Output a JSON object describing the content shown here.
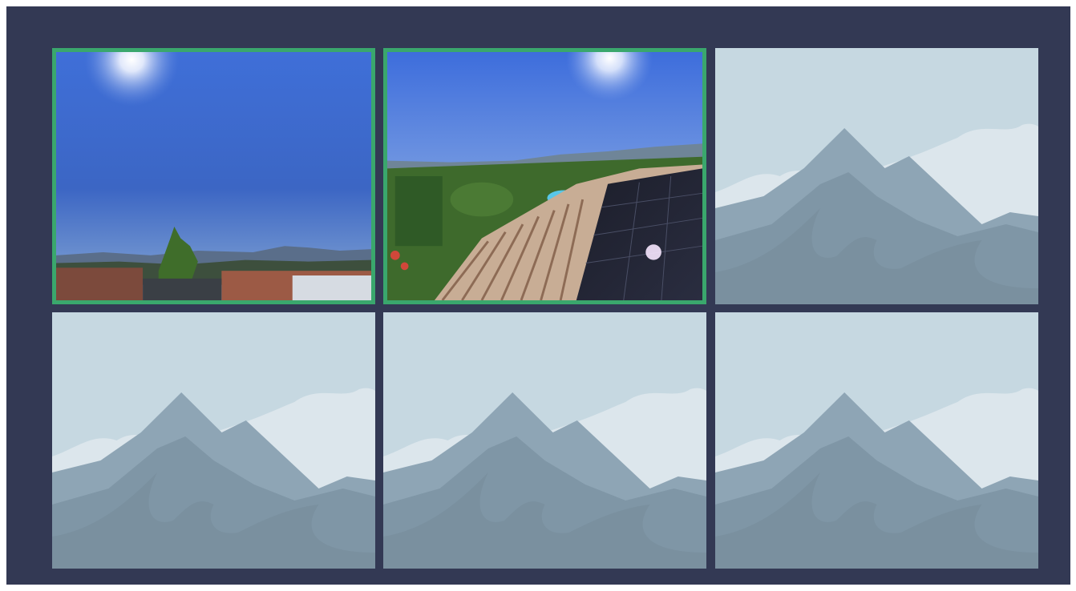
{
  "gallery": {
    "photos": [
      {
        "kind": "photo",
        "subject": "sky-over-rooftops",
        "selected": true
      },
      {
        "kind": "photo",
        "subject": "solar-panels-on-tile-roof",
        "selected": true
      },
      {
        "kind": "placeholder",
        "selected": false
      },
      {
        "kind": "placeholder",
        "selected": false
      },
      {
        "kind": "placeholder",
        "selected": false
      },
      {
        "kind": "placeholder",
        "selected": false
      }
    ],
    "colors": {
      "background": "#333954",
      "selection_border": "#3aa76d",
      "placeholder_sky": "#c6d8e1",
      "placeholder_mountain": "#8ea5b5"
    }
  }
}
